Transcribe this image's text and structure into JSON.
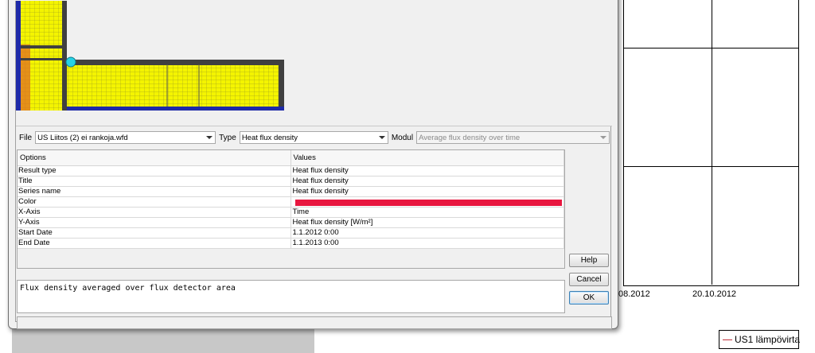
{
  "background_chart": {
    "x_tick_labels": [
      "08.2012",
      "20.10.2012"
    ],
    "legend_label": "US1 lämpövirta",
    "series_color": "#c0303a"
  },
  "dialog": {
    "file_label": "File",
    "file_value": "US Liitos (2) ei rankoja.wfd",
    "type_label": "Type",
    "type_value": "Heat flux density",
    "modul_label": "Modul",
    "modul_value": "Average flux density over time",
    "table": {
      "headers": [
        "Options",
        "Values"
      ],
      "rows": [
        {
          "option": "Result type",
          "value": "Heat flux density"
        },
        {
          "option": "Title",
          "value": "Heat flux density"
        },
        {
          "option": "Series name",
          "value": "Heat flux density"
        },
        {
          "option": "Color",
          "value": "",
          "color": "#e8173f"
        },
        {
          "option": "X-Axis",
          "value": "Time"
        },
        {
          "option": "Y-Axis",
          "value": "Heat flux density [W/m²]"
        },
        {
          "option": "Start Date",
          "value": "1.1.2012 0:00"
        },
        {
          "option": "End Date",
          "value": "1.1.2013 0:00"
        }
      ]
    },
    "description": "Flux density averaged over flux detector area",
    "buttons": {
      "help": "Help",
      "cancel": "Cancel",
      "ok": "OK"
    }
  },
  "colors": {
    "model_fill": "#f4f400",
    "model_outline": "#404040",
    "model_edge": "#1e2aa8",
    "model_accent": "#e07020",
    "node_marker": "#27d2e6"
  }
}
